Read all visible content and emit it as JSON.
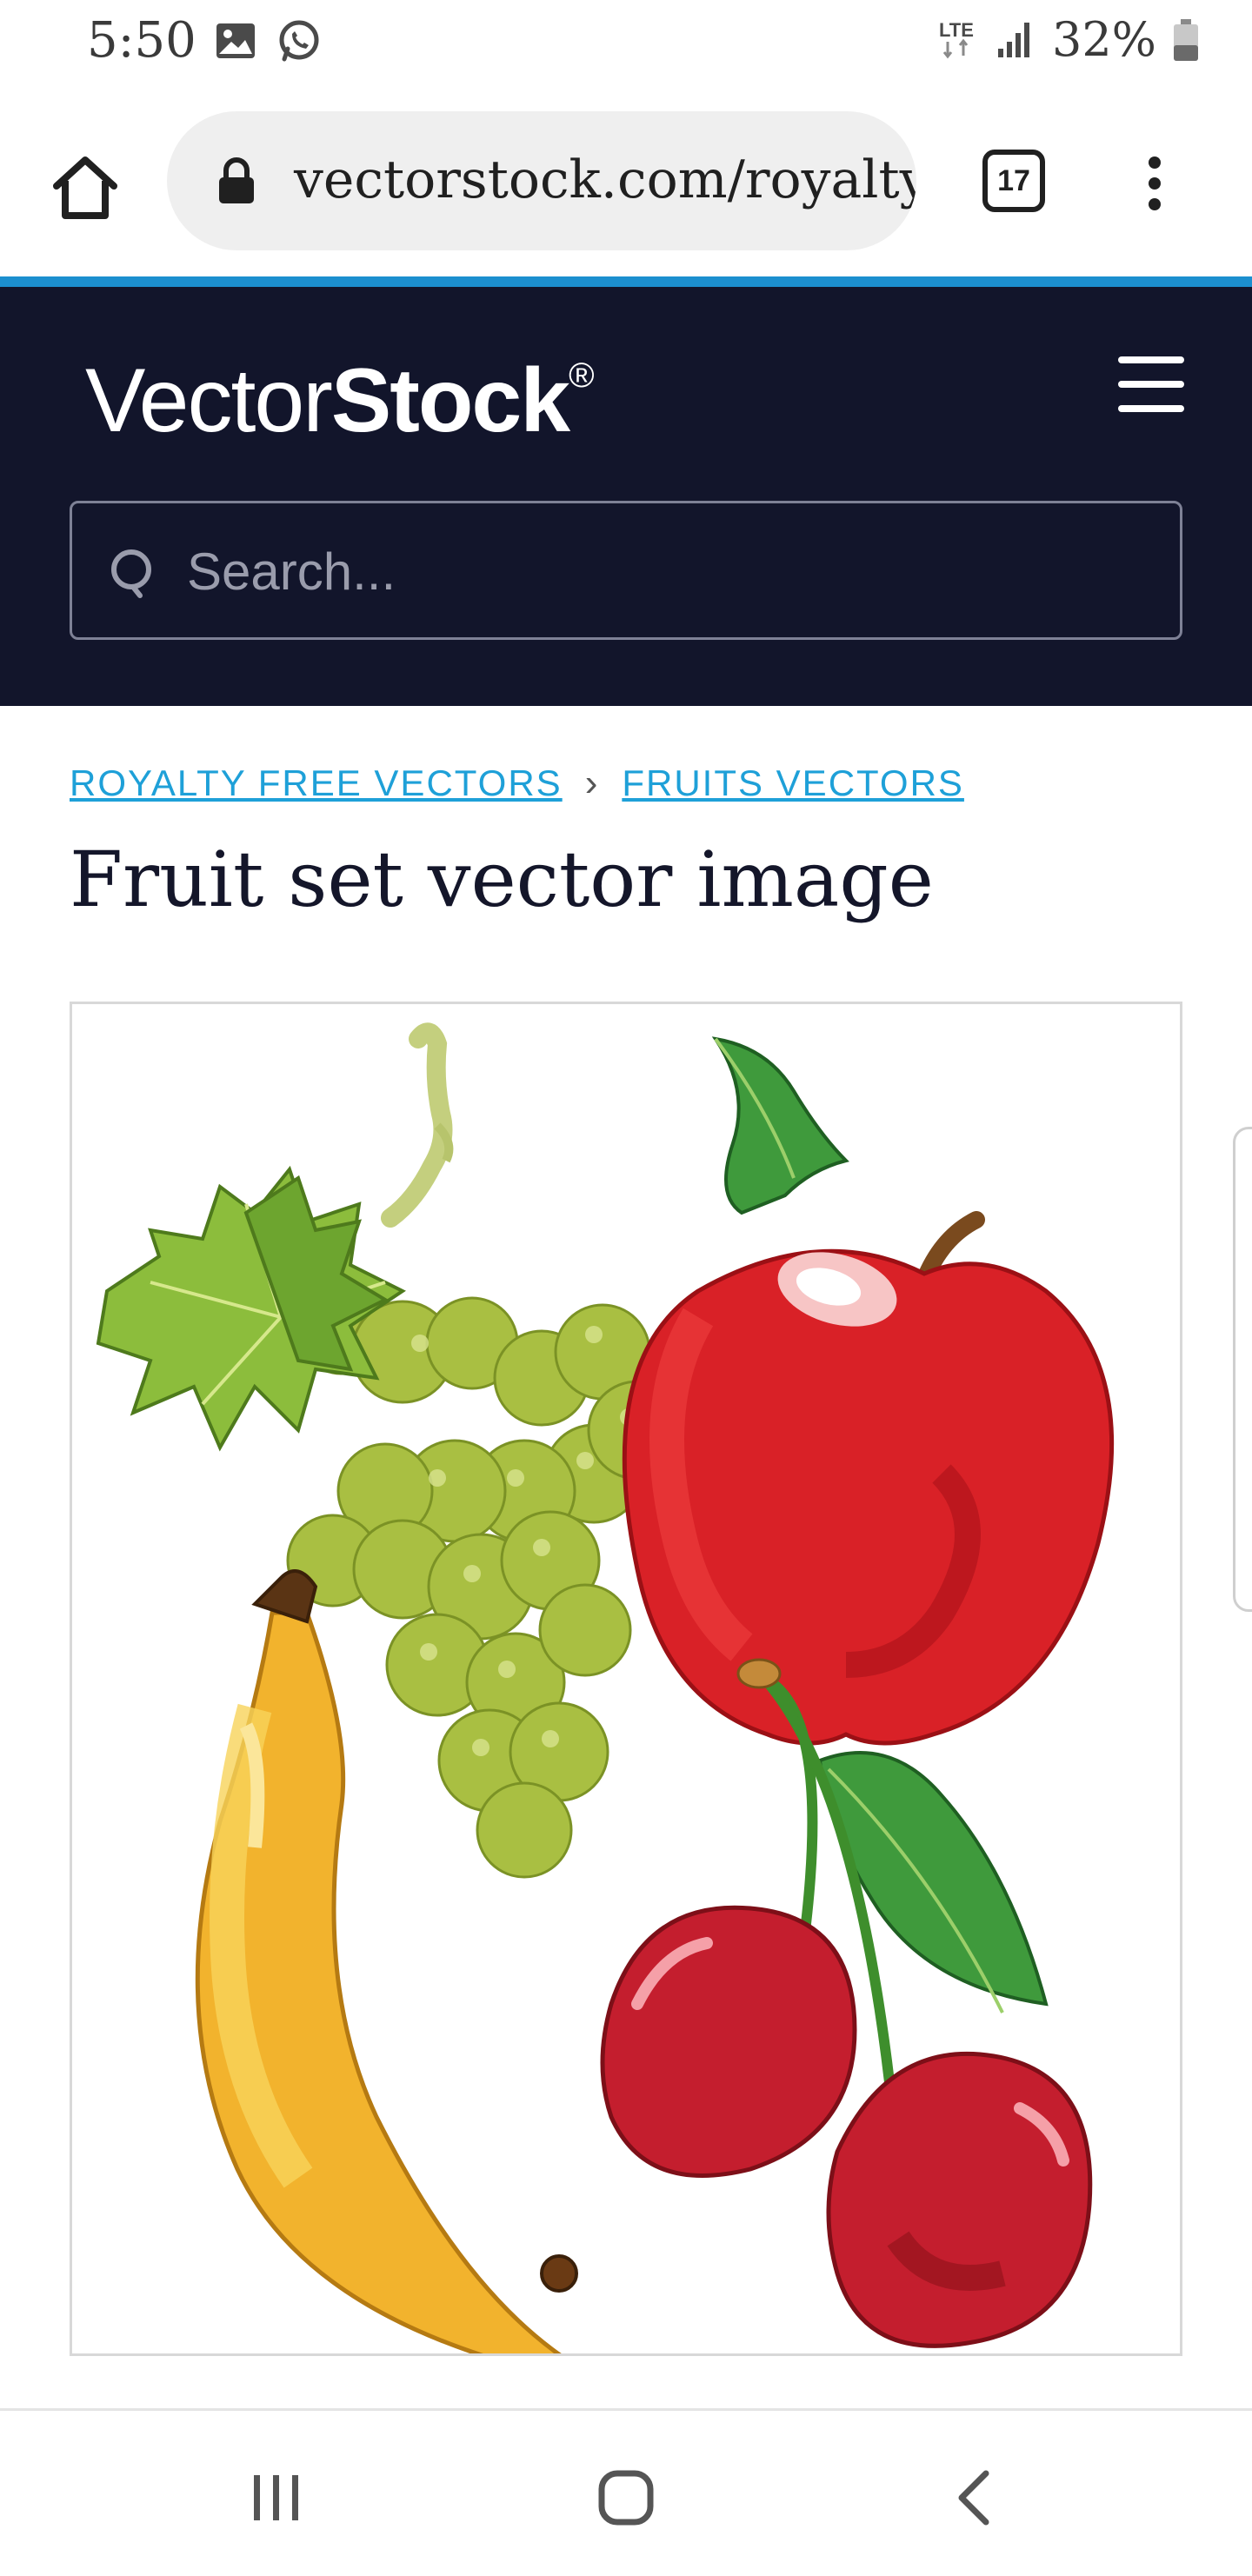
{
  "status_bar": {
    "time": "5:50",
    "network": "LTE",
    "battery": "32%",
    "icons": [
      "gallery-icon",
      "whatsapp-icon",
      "lte-icon",
      "signal-icon",
      "battery-icon"
    ]
  },
  "browser": {
    "url": "vectorstock.com/royalty",
    "tab_count": "17",
    "icons": [
      "home-icon",
      "lock-icon",
      "tabs-icon",
      "more-vert-icon"
    ]
  },
  "site": {
    "logo_light": "Vector",
    "logo_bold": "Stock",
    "logo_reg": "®",
    "search_placeholder": "Search...",
    "icons": [
      "search-icon",
      "hamburger-menu-icon"
    ]
  },
  "breadcrumb": {
    "items": [
      "ROYALTY FREE VECTORS",
      "FRUITS VECTORS"
    ],
    "separator": "›"
  },
  "page": {
    "title": "Fruit set vector image"
  },
  "image": {
    "contents": [
      "grapes",
      "apple",
      "banana",
      "cherries"
    ]
  },
  "nav_bar": {
    "icons": [
      "recent-apps-icon",
      "home-circle-icon",
      "back-icon"
    ]
  },
  "colors": {
    "header_bg": "#12152b",
    "accent_blue": "#1c8fcf",
    "link": "#1ea0d8"
  }
}
